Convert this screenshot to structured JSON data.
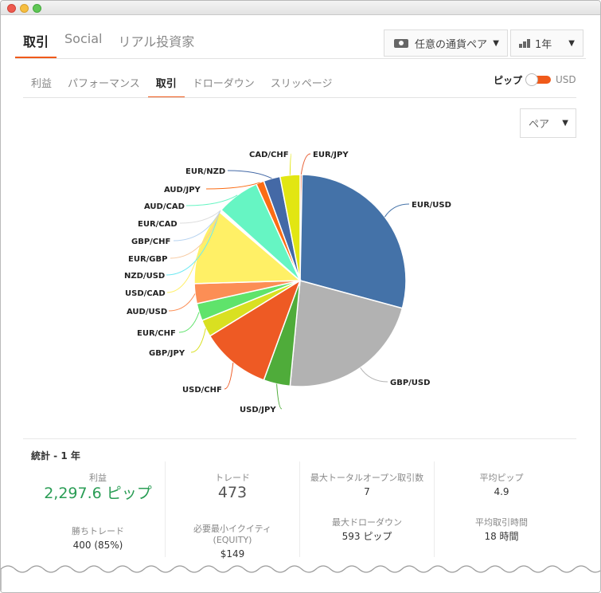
{
  "tabs": {
    "main": [
      {
        "label": "取引",
        "active": true
      },
      {
        "label": "Social",
        "active": false
      },
      {
        "label": "リアル投資家",
        "active": false
      }
    ],
    "sub": [
      {
        "label": "利益",
        "active": false
      },
      {
        "label": "パフォーマンス",
        "active": false
      },
      {
        "label": "取引",
        "active": true
      },
      {
        "label": "ドローダウン",
        "active": false
      },
      {
        "label": "スリッページ",
        "active": false
      }
    ]
  },
  "filters": {
    "pair_dropdown": "任意の通貨ペア",
    "period_dropdown": "1年",
    "group_dropdown": "ペア"
  },
  "unit_toggle": {
    "left_label": "ピップ",
    "right_label": "USD",
    "selected": "ピップ"
  },
  "chart_data": {
    "type": "pie",
    "slices": [
      {
        "label": "EUR/JPY",
        "value": 0.3,
        "color": "#e8643a"
      },
      {
        "label": "EUR/USD",
        "value": 28.5,
        "color": "#4472a8"
      },
      {
        "label": "GBP/USD",
        "value": 22.0,
        "color": "#b2b2b2"
      },
      {
        "label": "USD/JPY",
        "value": 4.0,
        "color": "#4fac3a"
      },
      {
        "label": "USD/CHF",
        "value": 10.5,
        "color": "#ee5a24"
      },
      {
        "label": "GBP/JPY",
        "value": 2.6,
        "color": "#d9e021"
      },
      {
        "label": "EUR/CHF",
        "value": 2.6,
        "color": "#5fe36b"
      },
      {
        "label": "AUD/USD",
        "value": 3.0,
        "color": "#fc8e55"
      },
      {
        "label": "USD/CAD",
        "value": 11.5,
        "color": "#fff066"
      },
      {
        "label": "NZD/USD",
        "value": 0.1,
        "color": "#6ee9f2"
      },
      {
        "label": "EUR/GBP",
        "value": 0.1,
        "color": "#f7c9a0"
      },
      {
        "label": "GBP/CHF",
        "value": 0.1,
        "color": "#b7d3f0"
      },
      {
        "label": "EUR/CAD",
        "value": 0.1,
        "color": "#dcdcdc"
      },
      {
        "label": "AUD/CAD",
        "value": 6.5,
        "color": "#66f5c3"
      },
      {
        "label": "AUD/JPY",
        "value": 1.2,
        "color": "#fb6c14"
      },
      {
        "label": "EUR/NZD",
        "value": 2.5,
        "color": "#4469a6"
      },
      {
        "label": "CAD/CHF",
        "value": 3.0,
        "color": "#e2e612"
      }
    ]
  },
  "stats": {
    "title": "統計 - 1 年",
    "profit_label": "利益",
    "profit_value": "2,297.6 ピップ",
    "trades_label": "トレード",
    "trades_value": "473",
    "max_open_label": "最大トータルオープン取引数",
    "max_open_value": "7",
    "avg_pips_label": "平均ピップ",
    "avg_pips_value": "4.9",
    "win_label": "勝ちトレード",
    "win_value": "400 (85%)",
    "min_equity_label": "必要最小イクイティ (EQUITY)",
    "min_equity_value": "$149",
    "max_dd_label": "最大ドローダウン",
    "max_dd_value": "593 ピップ",
    "avg_time_label": "平均取引時間",
    "avg_time_value": "18 時間"
  }
}
